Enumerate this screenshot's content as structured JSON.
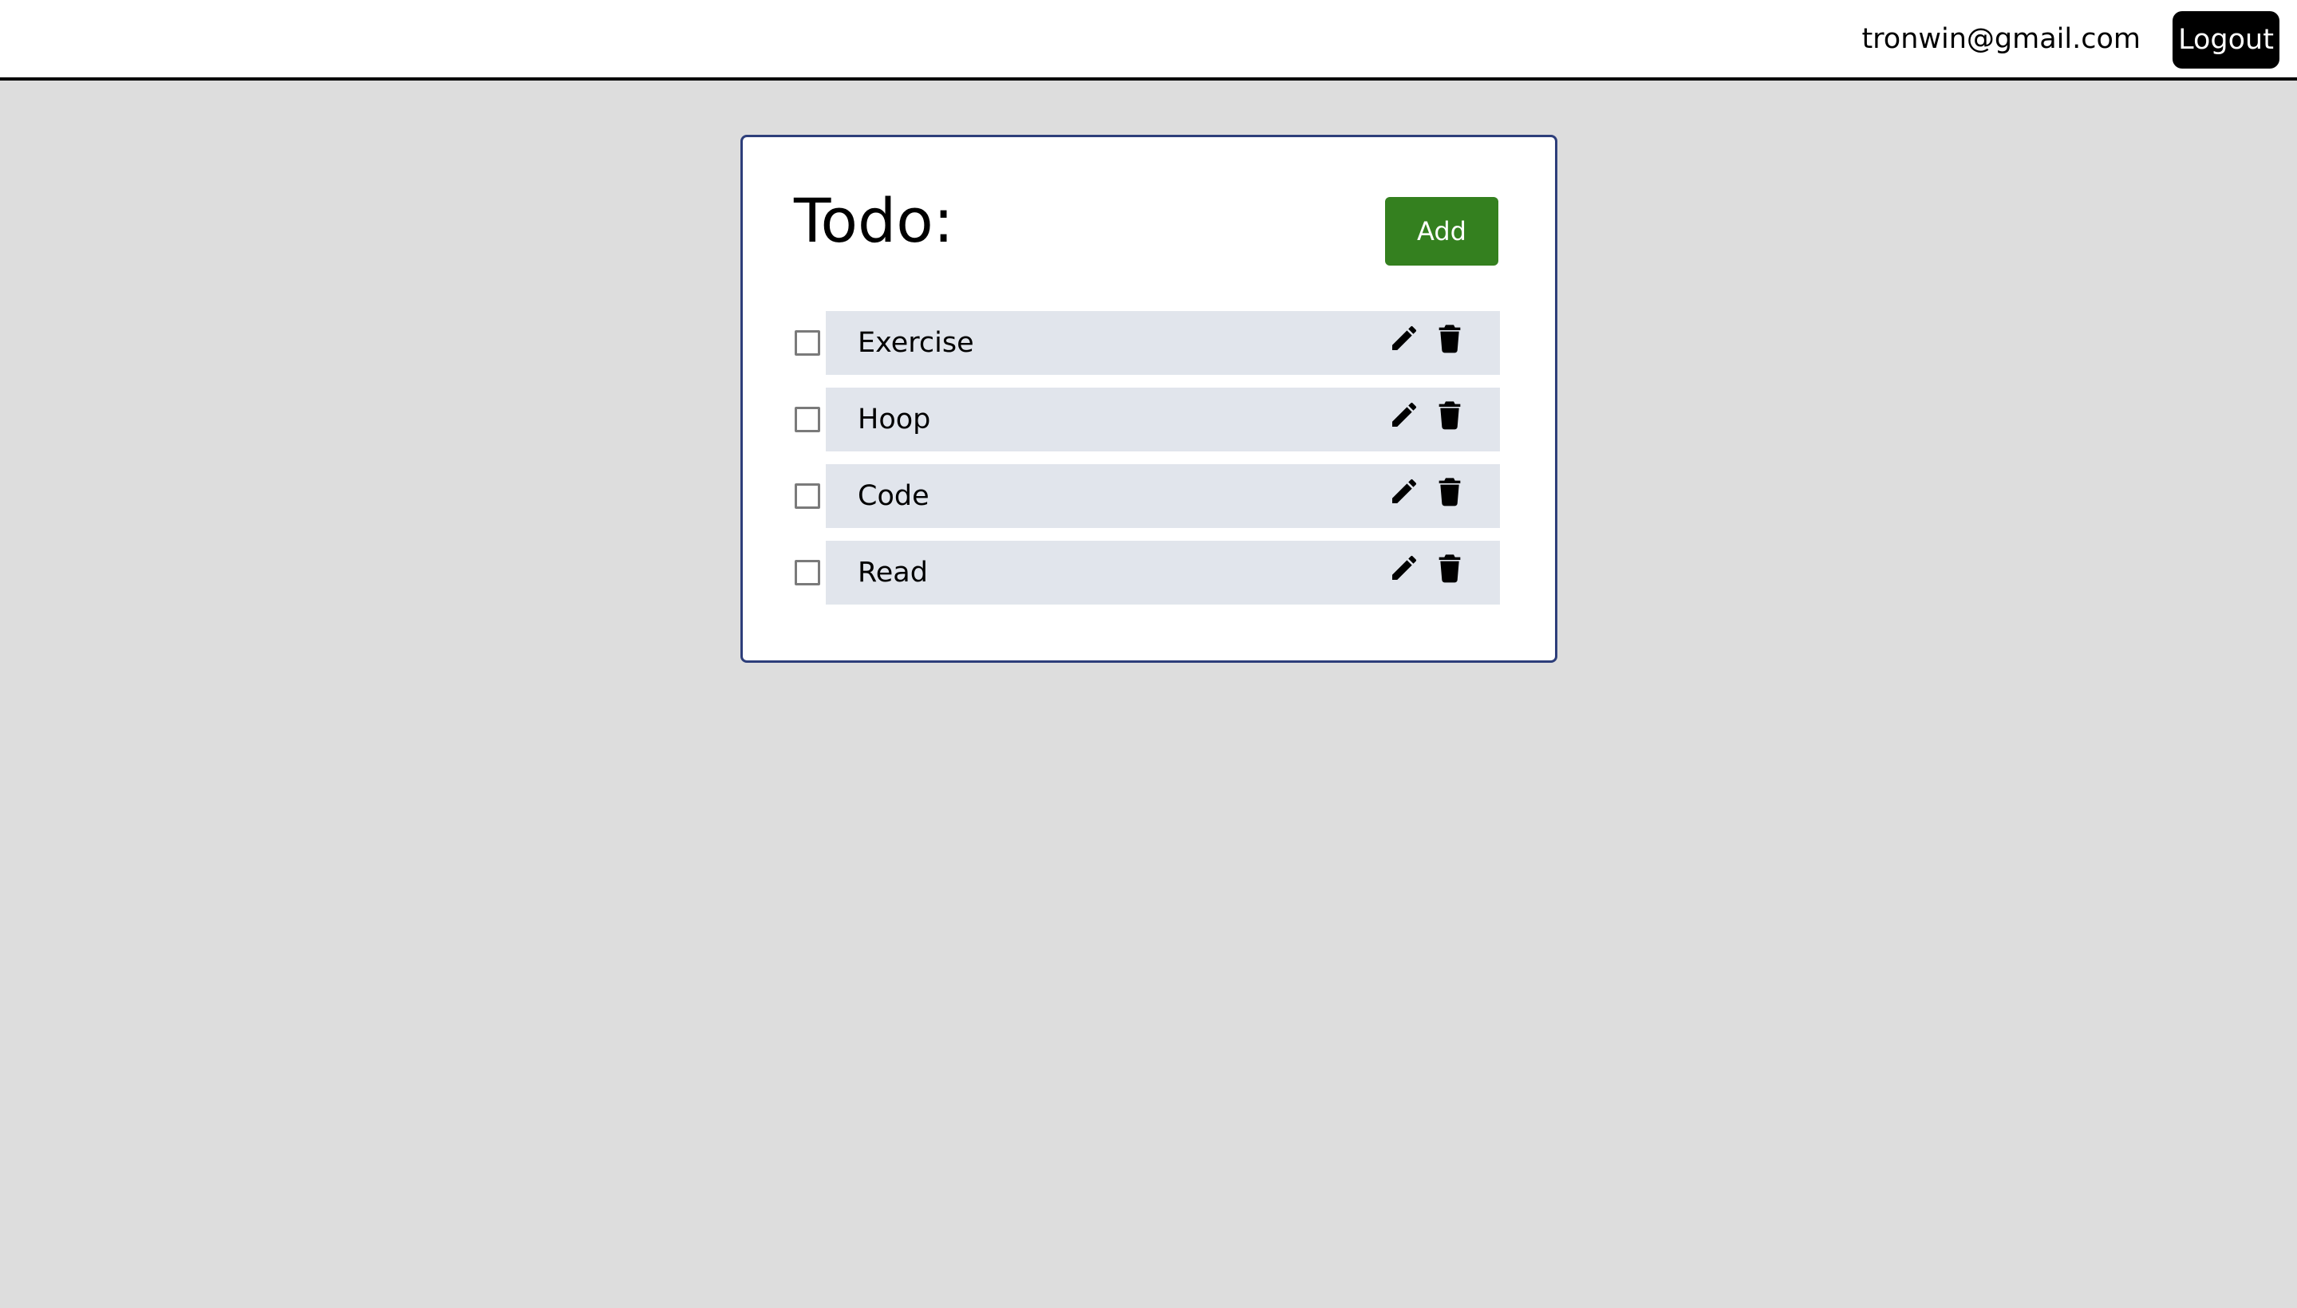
{
  "header": {
    "user_email": "tronwin@gmail.com",
    "logout_label": "Logout"
  },
  "todo": {
    "title": "Todo:",
    "add_label": "Add",
    "items": [
      {
        "label": "Exercise",
        "checked": false
      },
      {
        "label": "Hoop",
        "checked": false
      },
      {
        "label": "Code",
        "checked": false
      },
      {
        "label": "Read",
        "checked": false
      }
    ]
  },
  "icons": {
    "edit": "pencil-icon",
    "delete": "trash-icon"
  },
  "colors": {
    "background": "#dddddd",
    "add_button": "#34801f",
    "logout_button": "#000000",
    "card_border": "#2d3e7a",
    "item_background": "#e1e5ec"
  }
}
